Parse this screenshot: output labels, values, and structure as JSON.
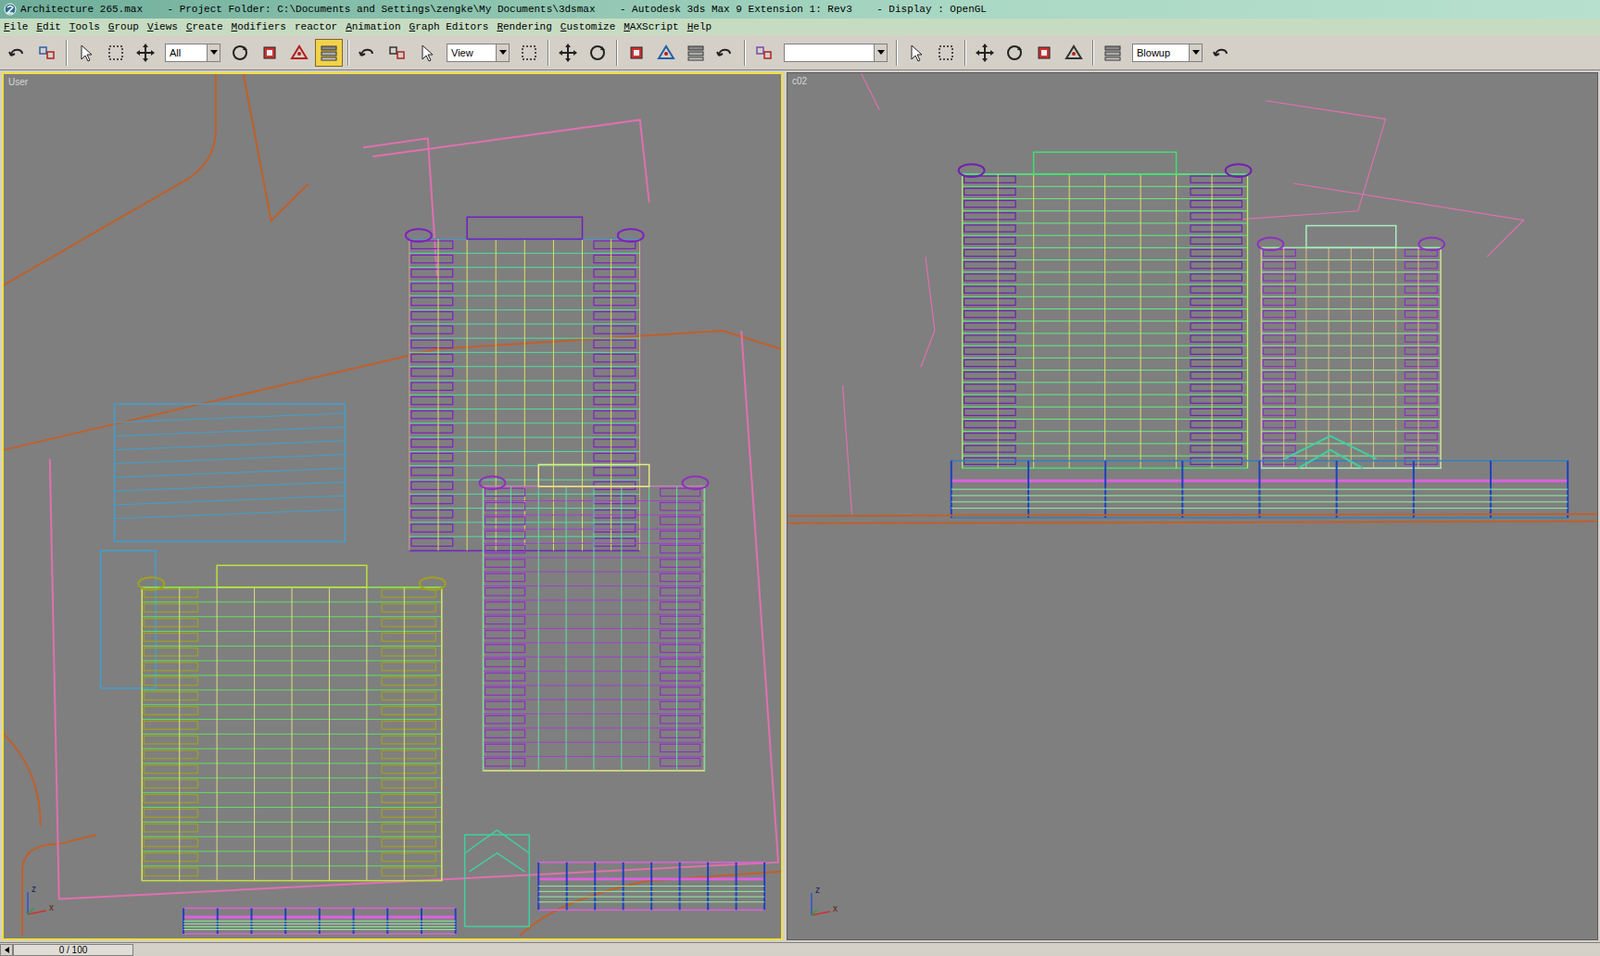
{
  "window": {
    "title": "Architecture 265.max    - Project Folder: C:\\Documents and Settings\\zengke\\My Documents\\3dsmax    - Autodesk 3ds Max 9 Extension 1: Rev3    - Display : OpenGL"
  },
  "menu": [
    {
      "label": "File",
      "mnemonic": true
    },
    {
      "label": "Edit",
      "mnemonic": true
    },
    {
      "label": "Tools",
      "mnemonic": true
    },
    {
      "label": "Group",
      "mnemonic": true
    },
    {
      "label": "Views",
      "mnemonic": true
    },
    {
      "label": "Create",
      "mnemonic": true
    },
    {
      "label": "Modifiers",
      "mnemonic": true
    },
    {
      "label": "reactor",
      "mnemonic": false
    },
    {
      "label": "Animation",
      "mnemonic": true
    },
    {
      "label": "Graph Editors",
      "mnemonic": true
    },
    {
      "label": "Rendering",
      "mnemonic": true
    },
    {
      "label": "Customize",
      "mnemonic": true
    },
    {
      "label": "MAXScript",
      "mnemonic": true
    },
    {
      "label": "Help",
      "mnemonic": true
    }
  ],
  "toolbar": [
    {
      "kind": "button",
      "selected": false
    },
    {
      "kind": "button",
      "selected": false
    },
    {
      "kind": "separator"
    },
    {
      "kind": "button",
      "selected": false
    },
    {
      "kind": "button",
      "selected": false
    },
    {
      "kind": "button",
      "selected": false
    },
    {
      "kind": "dropdown",
      "value": "All"
    },
    {
      "kind": "button",
      "selected": false
    },
    {
      "kind": "button",
      "selected": false
    },
    {
      "kind": "button",
      "selected": false
    },
    {
      "kind": "button",
      "selected": true
    },
    {
      "kind": "separator"
    },
    {
      "kind": "button",
      "selected": false
    },
    {
      "kind": "button",
      "selected": false
    },
    {
      "kind": "button",
      "selected": false
    },
    {
      "kind": "dropdown",
      "value": "View"
    },
    {
      "kind": "button",
      "selected": false
    },
    {
      "kind": "separator"
    },
    {
      "kind": "button",
      "selected": false
    },
    {
      "kind": "button",
      "selected": false
    },
    {
      "kind": "separator"
    },
    {
      "kind": "button",
      "selected": false
    },
    {
      "kind": "button",
      "selected": false
    },
    {
      "kind": "button",
      "selected": false
    },
    {
      "kind": "button",
      "selected": false
    },
    {
      "kind": "separator"
    },
    {
      "kind": "button",
      "selected": false
    },
    {
      "kind": "dropdown",
      "value": ""
    },
    {
      "kind": "separator"
    },
    {
      "kind": "button",
      "selected": false
    },
    {
      "kind": "button",
      "selected": false
    },
    {
      "kind": "separator"
    },
    {
      "kind": "button",
      "selected": false
    },
    {
      "kind": "button",
      "selected": false
    },
    {
      "kind": "button",
      "selected": false
    },
    {
      "kind": "button",
      "selected": false
    },
    {
      "kind": "separator"
    },
    {
      "kind": "button",
      "selected": false
    },
    {
      "kind": "dropdown",
      "value": "Blowup"
    },
    {
      "kind": "button",
      "selected": false
    }
  ],
  "viewports": [
    {
      "label": "User",
      "active": true,
      "axes": [
        "z",
        "x"
      ]
    },
    {
      "label": "c02",
      "active": false,
      "axes": [
        "z",
        "x"
      ]
    }
  ],
  "timeline": {
    "frame": "0 / 100"
  }
}
